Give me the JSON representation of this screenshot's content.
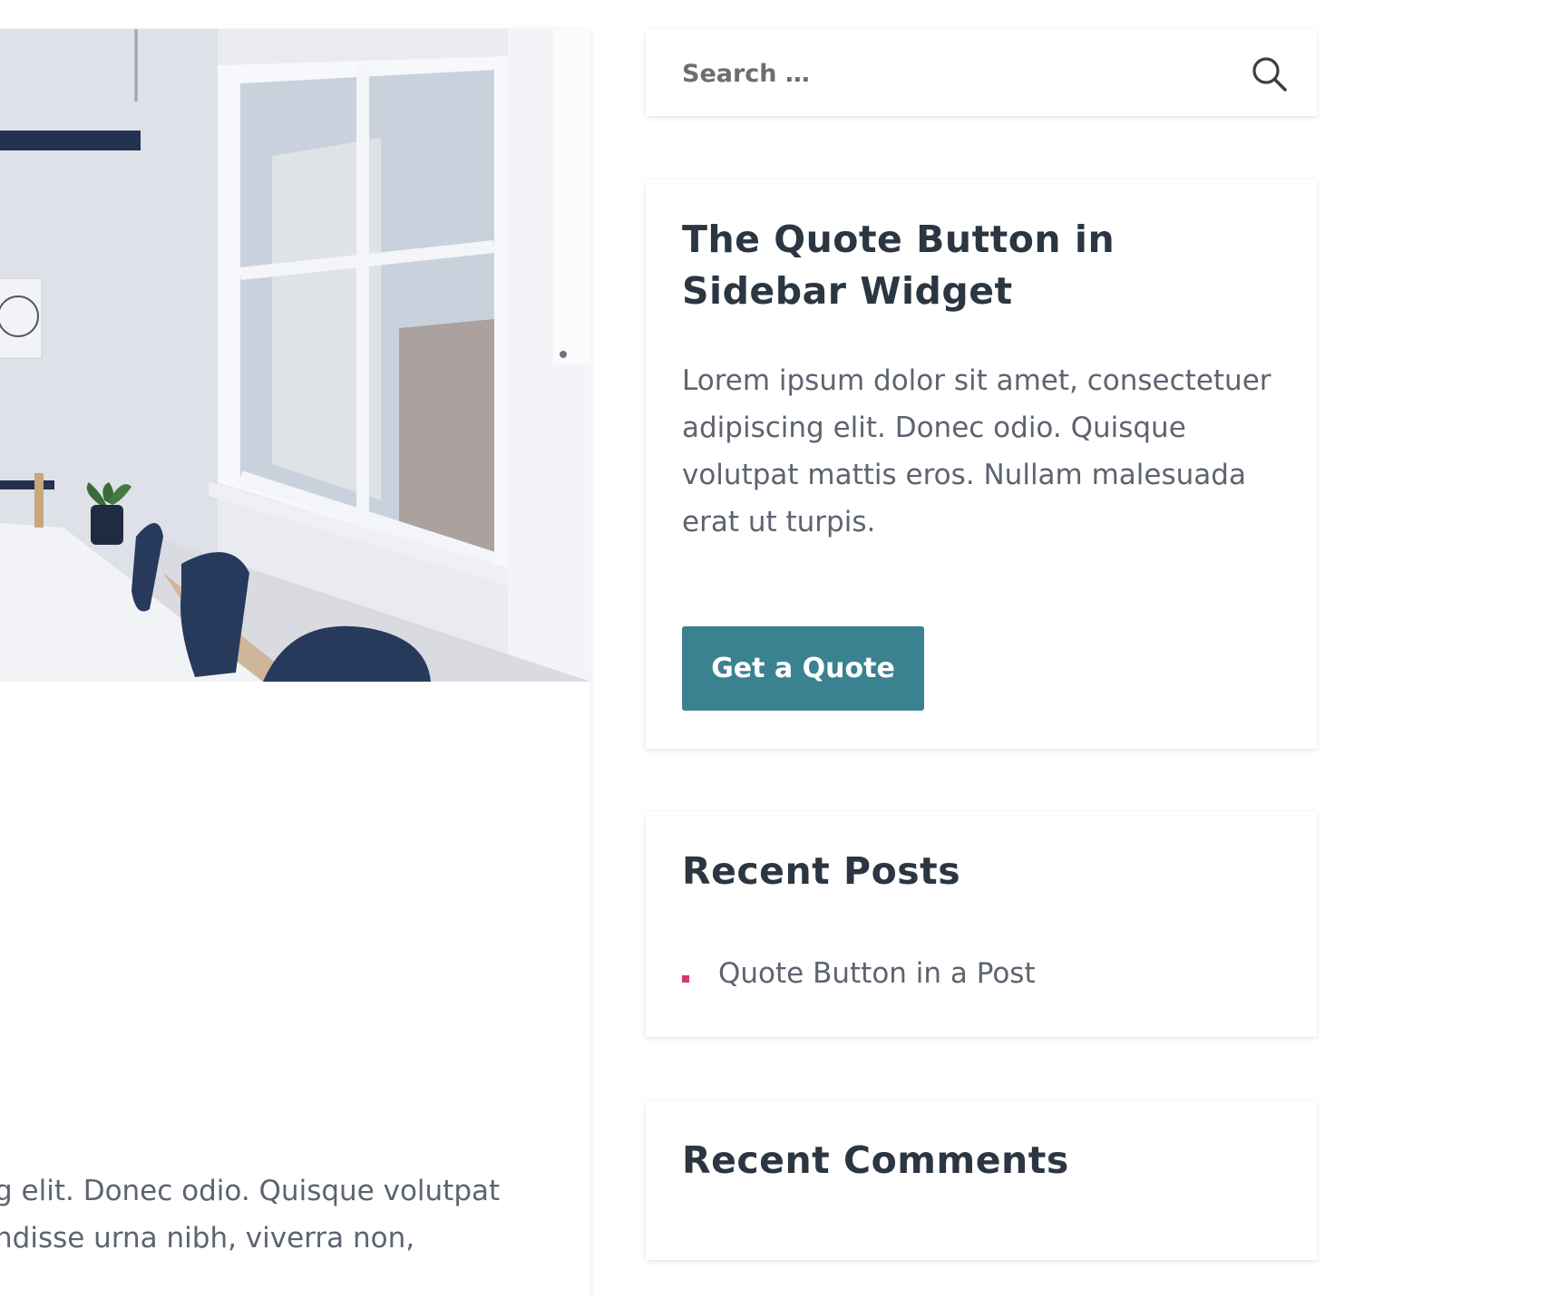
{
  "sidebar": {
    "search": {
      "placeholder": "Search …",
      "icon": "search-icon"
    },
    "quote_widget": {
      "title": "The Quote Button in Sidebar Widget",
      "text": "Lorem ipsum dolor sit amet, consectetuer adipiscing elit. Donec odio. Quisque volutpat mattis eros. Nullam malesuada erat ut turpis.",
      "button_label": "Get a Quote",
      "button_color": "#3b8290"
    },
    "recent_posts": {
      "title": "Recent Posts",
      "items": [
        {
          "label": "Quote Button in a Post"
        }
      ],
      "bullet_color": "#d43a66"
    },
    "recent_comments": {
      "title": "Recent Comments"
    }
  },
  "main": {
    "featured_image": "office-meeting-room-photo",
    "excerpt_lines": [
      "g elit. Donec odio. Quisque volutpat",
      "ndisse urna nibh, viverra non,"
    ]
  }
}
